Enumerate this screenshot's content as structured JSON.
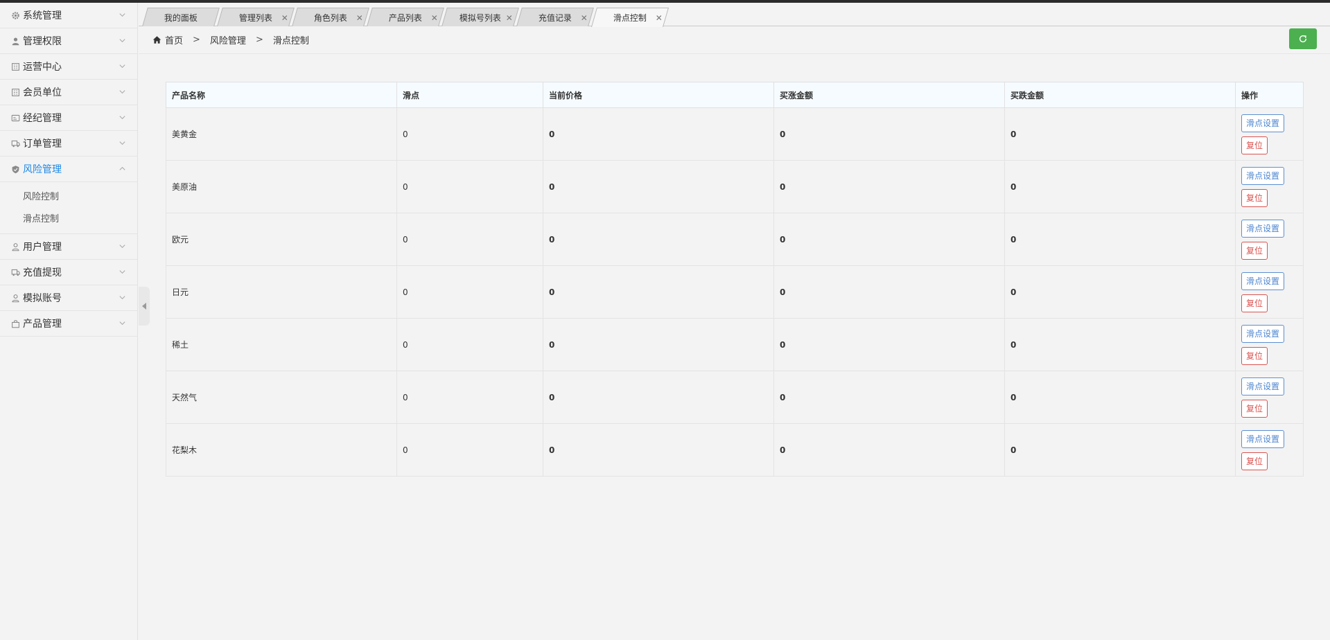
{
  "sidebar": {
    "items": [
      {
        "label": "系统管理",
        "icon": "gear-icon"
      },
      {
        "label": "管理权限",
        "icon": "user-icon"
      },
      {
        "label": "运营中心",
        "icon": "building-icon"
      },
      {
        "label": "会员单位",
        "icon": "building-icon"
      },
      {
        "label": "经纪管理",
        "icon": "card-icon"
      },
      {
        "label": "订单管理",
        "icon": "truck-icon"
      },
      {
        "label": "风险管理",
        "icon": "shield-icon",
        "active": true
      },
      {
        "label": "用户管理",
        "icon": "user-outline-icon"
      },
      {
        "label": "充值提现",
        "icon": "truck-icon"
      },
      {
        "label": "模拟账号",
        "icon": "user-outline-icon"
      },
      {
        "label": "产品管理",
        "icon": "bag-icon"
      }
    ],
    "risk_sub": [
      "风险控制",
      "滑点控制"
    ]
  },
  "tabs": [
    {
      "label": "我的面板",
      "closable": false
    },
    {
      "label": "管理列表",
      "closable": true
    },
    {
      "label": "角色列表",
      "closable": true
    },
    {
      "label": "产品列表",
      "closable": true
    },
    {
      "label": "模拟号列表",
      "closable": true
    },
    {
      "label": "充值记录",
      "closable": true
    },
    {
      "label": "滑点控制",
      "closable": true,
      "active": true
    }
  ],
  "tab_close_glyph": "✕",
  "breadcrumb": {
    "home": "首页",
    "separator": ">",
    "section": "风险管理",
    "current": "滑点控制"
  },
  "table": {
    "headers": [
      "产品名称",
      "滑点",
      "当前价格",
      "买涨金额",
      "买跌金额",
      "操作"
    ],
    "rows": [
      {
        "name": "美黄金",
        "slip": "0",
        "price": "0",
        "buy_up": "0",
        "buy_down": "0"
      },
      {
        "name": "美原油",
        "slip": "0",
        "price": "0",
        "buy_up": "0",
        "buy_down": "0"
      },
      {
        "name": "欧元",
        "slip": "0",
        "price": "0",
        "buy_up": "0",
        "buy_down": "0"
      },
      {
        "name": "日元",
        "slip": "0",
        "price": "0",
        "buy_up": "0",
        "buy_down": "0"
      },
      {
        "name": "稀土",
        "slip": "0",
        "price": "0",
        "buy_up": "0",
        "buy_down": "0"
      },
      {
        "name": "天然气",
        "slip": "0",
        "price": "0",
        "buy_up": "0",
        "buy_down": "0"
      },
      {
        "name": "花梨木",
        "slip": "0",
        "price": "0",
        "buy_up": "0",
        "buy_down": "0"
      }
    ],
    "slip_button_label": "滑点设置",
    "reset_button_label": "复位"
  },
  "colors": {
    "accent": "#1e88e5",
    "refresh_button": "#4caf50",
    "buy_up": "#e00000",
    "buy_down": "#00910a",
    "slip_button": "#4d86cf",
    "reset_button": "#d9534f"
  }
}
